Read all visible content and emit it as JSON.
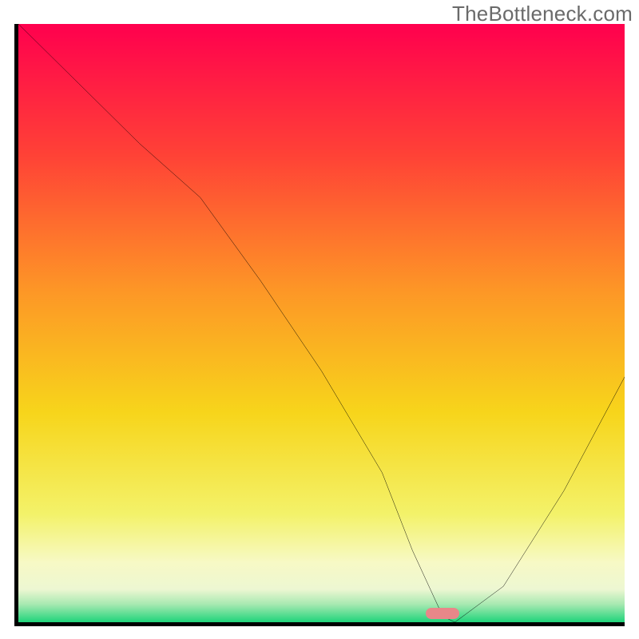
{
  "watermark": "TheBottleneck.com",
  "chart_data": {
    "type": "line",
    "title": "",
    "xlabel": "",
    "ylabel": "",
    "xlim": [
      0,
      100
    ],
    "ylim": [
      0,
      100
    ],
    "x": [
      0,
      10,
      20,
      30,
      40,
      50,
      60,
      65,
      70,
      72,
      80,
      90,
      100
    ],
    "values": [
      100,
      90,
      80,
      71,
      57,
      42,
      25,
      12,
      1,
      0,
      6,
      22,
      41
    ],
    "optimum_x": 70,
    "optimum_y": 1.5,
    "gradient_stops": [
      {
        "offset": 0,
        "color": "#ff004e"
      },
      {
        "offset": 0.22,
        "color": "#ff4236"
      },
      {
        "offset": 0.45,
        "color": "#fd9826"
      },
      {
        "offset": 0.65,
        "color": "#f7d51b"
      },
      {
        "offset": 0.82,
        "color": "#f3f26a"
      },
      {
        "offset": 0.9,
        "color": "#f7f9c5"
      },
      {
        "offset": 0.945,
        "color": "#edf7d2"
      },
      {
        "offset": 0.97,
        "color": "#a7e9b1"
      },
      {
        "offset": 1.0,
        "color": "#1fd47a"
      }
    ]
  }
}
